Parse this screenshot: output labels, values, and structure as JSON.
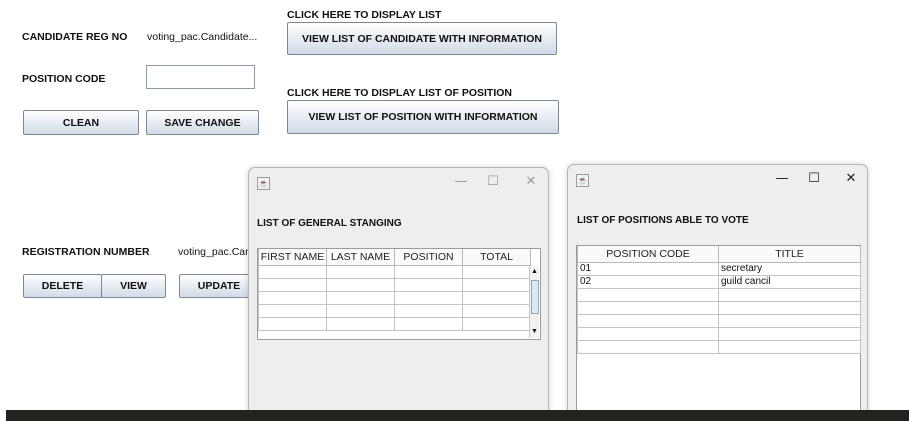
{
  "form": {
    "candidate_reg_label": "CANDIDATE REG NO",
    "candidate_reg_value": "voting_pac.Candidate...",
    "position_code_label": "POSITION CODE",
    "position_code_value": "",
    "clean_label": "CLEAN",
    "save_change_label": "SAVE CHANGE",
    "display_list_label": "CLICK HERE TO DISPLAY LIST",
    "view_candidates_label": "VIEW LIST OF CANDIDATE WITH INFORMATION",
    "display_position_label": "CLICK HERE TO DISPLAY LIST OF POSITION",
    "view_positions_label": "VIEW LIST OF POSITION WITH INFORMATION",
    "registration_number_label": "REGISTRATION NUMBER",
    "registration_number_value": "voting_pac.Can",
    "delete_label": "DELETE",
    "view_label": "VIEW",
    "update_label": "UPDATE"
  },
  "standing_window": {
    "heading": "LIST OF  GENERAL STANGING",
    "minimize_glyph": "—",
    "maximize_glyph": "☐",
    "close_glyph": "✕",
    "columns": [
      "FIRST NAME",
      "LAST NAME",
      "POSITION",
      "TOTAL"
    ]
  },
  "positions_window": {
    "heading": "LIST OF  POSITIONS ABLE TO VOTE",
    "minimize_glyph": "—",
    "maximize_glyph": "☐",
    "close_glyph": "✕",
    "columns": [
      "POSITION CODE",
      "TITLE"
    ],
    "rows": [
      {
        "code": "01",
        "title": "secretary"
      },
      {
        "code": "02",
        "title": "guild cancil"
      }
    ]
  }
}
